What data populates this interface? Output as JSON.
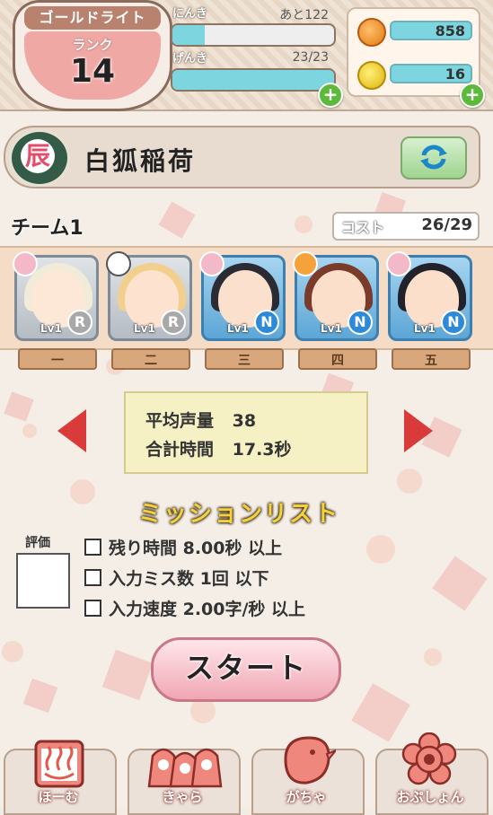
{
  "header": {
    "rank_title": "ゴールドライト",
    "rank_label": "ランク",
    "rank_value": "14",
    "ninki": {
      "label": "にんき",
      "value": "あと122",
      "level": 0.2
    },
    "genki": {
      "label": "げんき",
      "value": "23/23",
      "level": 1.0
    },
    "currency": [
      {
        "icon": "orange-coin-icon",
        "value": "858"
      },
      {
        "icon": "gold-coin-icon",
        "value": "16"
      }
    ]
  },
  "course": {
    "badge": "辰",
    "name": "白狐稲荷"
  },
  "team": {
    "title": "チーム1",
    "cost_label": "コスト",
    "cost_value": "26/29",
    "members": [
      {
        "level": "Lv1",
        "rarity": "R",
        "slot": "一"
      },
      {
        "level": "Lv1",
        "rarity": "R",
        "slot": "二"
      },
      {
        "level": "Lv1",
        "rarity": "N",
        "slot": "三"
      },
      {
        "level": "Lv1",
        "rarity": "N",
        "slot": "四"
      },
      {
        "level": "Lv1",
        "rarity": "N",
        "slot": "五"
      }
    ]
  },
  "stats": {
    "avg_volume_label": "平均声量",
    "avg_volume_value": "38",
    "total_time_label": "合計時間",
    "total_time_value": "17.3秒"
  },
  "mission": {
    "title": "ミッションリスト",
    "eval_label": "評価",
    "items": [
      "残り時間 8.00秒 以上",
      "入力ミス数 1回 以下",
      "入力速度 2.00字/秒 以上"
    ]
  },
  "start_label": "スタート",
  "nav": [
    {
      "label": "ほーむ",
      "icon": "onsen-icon"
    },
    {
      "label": "きゃら",
      "icon": "characters-icon"
    },
    {
      "label": "がちゃ",
      "icon": "bird-icon"
    },
    {
      "label": "おぷしょん",
      "icon": "flower-icon"
    }
  ],
  "colors": {
    "accent_pink": "#f0a8a4",
    "bar_cyan": "#7dd6df",
    "arrow_red": "#d93a3a",
    "mission_yellow": "#f4d238"
  }
}
